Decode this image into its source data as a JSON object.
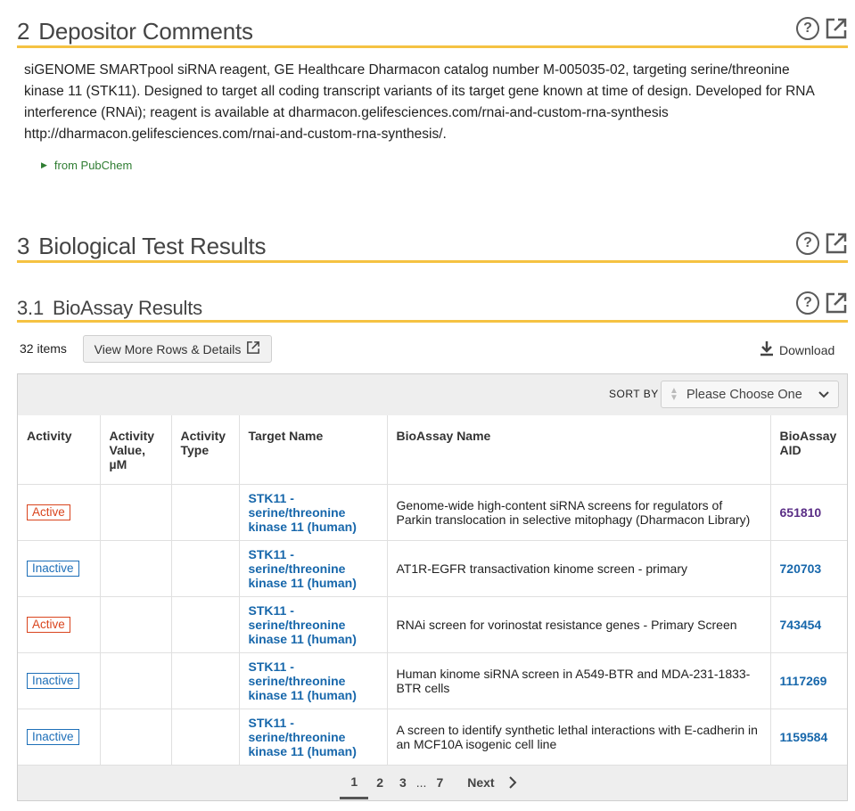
{
  "sections": {
    "depositor": {
      "num": "2",
      "title": "Depositor Comments"
    },
    "bio": {
      "num": "3",
      "title": "Biological Test Results"
    },
    "bioassay": {
      "num": "3.1",
      "title": "BioAssay Results"
    }
  },
  "comment": "siGENOME SMARTpool siRNA reagent, GE Healthcare Dharmacon catalog number M-005035-02, targeting serine/threonine kinase 11 (STK11). Designed to target all coding transcript variants of its target gene known at time of design. Developed for RNA interference (RNAi); reagent is available at dharmacon.gelifesciences.com/rnai-and-custom-rna-synthesis http://dharmacon.gelifesciences.com/rnai-and-custom-rna-synthesis/.",
  "from_label": "from PubChem",
  "toolbar": {
    "count": "32 items",
    "view_more": "View More Rows & Details",
    "download": "Download"
  },
  "sort": {
    "label": "SORT BY",
    "value": "Please Choose One"
  },
  "columns": [
    "Activity",
    "Activity Value, µM",
    "Activity Type",
    "Target Name",
    "BioAssay Name",
    "BioAssay AID"
  ],
  "rows": [
    {
      "activity": "Active",
      "target": "STK11 - serine/threonine kinase 11 (human)",
      "name": "Genome-wide high-content siRNA screens for regulators of Parkin translocation in selective mitophagy (Dharmacon Library)",
      "aid": "651810"
    },
    {
      "activity": "Inactive",
      "target": "STK11 - serine/threonine kinase 11 (human)",
      "name": "AT1R-EGFR transactivation kinome screen - primary",
      "aid": "720703"
    },
    {
      "activity": "Active",
      "target": "STK11 - serine/threonine kinase 11 (human)",
      "name": "RNAi screen for vorinostat resistance genes - Primary Screen",
      "aid": "743454"
    },
    {
      "activity": "Inactive",
      "target": "STK11 - serine/threonine kinase 11 (human)",
      "name": "Human kinome siRNA screen in A549-BTR and MDA-231-1833-BTR cells",
      "aid": "1117269"
    },
    {
      "activity": "Inactive",
      "target": "STK11 - serine/threonine kinase 11 (human)",
      "name": "A screen to identify synthetic lethal interactions with E-cadherin in an MCF10A isogenic cell line",
      "aid": "1159584"
    }
  ],
  "pager": {
    "p1": "1",
    "p2": "2",
    "p3": "3",
    "ellipsis": "...",
    "p7": "7",
    "next": "Next"
  },
  "colors": {
    "accent": "#f5c242",
    "active": "#d9441d",
    "inactive": "#1e6fb8",
    "link": "#1767ab"
  }
}
